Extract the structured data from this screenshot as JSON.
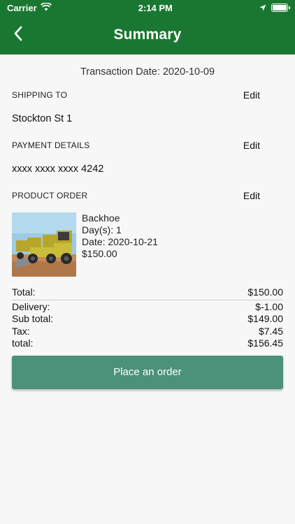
{
  "status_bar": {
    "carrier": "Carrier",
    "time": "2:14 PM"
  },
  "app_bar": {
    "title": "Summary",
    "back_icon": "chevron-left-icon"
  },
  "colors": {
    "app_bar": "#1a7732",
    "primary_button": "#4c917a"
  },
  "summary": {
    "transaction_date": "Transaction Date: 2020-10-09",
    "shipping": {
      "label": "SHIPPING TO",
      "edit_label": "Edit",
      "value": "Stockton St 1"
    },
    "payment": {
      "label": "PAYMENT DETAILS",
      "edit_label": "Edit",
      "value": "xxxx xxxx xxxx 4242"
    },
    "product_order": {
      "label": "PRODUCT ORDER",
      "edit_label": "Edit",
      "item": {
        "name": "Backhoe",
        "days": "Day(s): 1",
        "date": "Date: 2020-10-21",
        "price": "$150.00"
      }
    },
    "totals": [
      {
        "label": "Total:",
        "value": "$150.00"
      },
      {
        "label": "Delivery:",
        "value": "$-1.00"
      },
      {
        "label": "Sub total:",
        "value": "$149.00"
      },
      {
        "label": "Tax:",
        "value": "$7.45"
      },
      {
        "label": "total:",
        "value": "$156.45"
      }
    ],
    "order_button": "Place an order"
  }
}
